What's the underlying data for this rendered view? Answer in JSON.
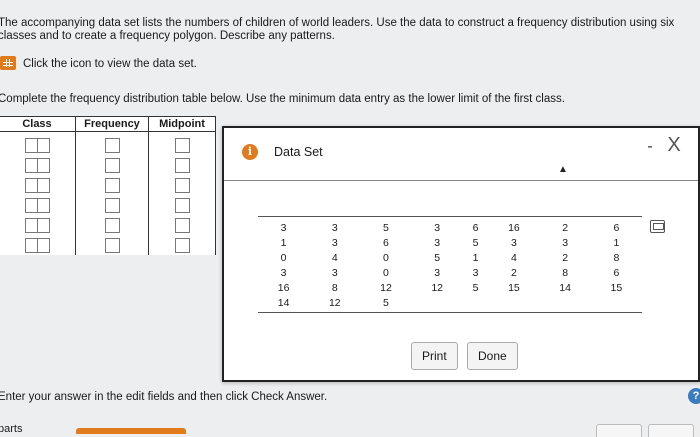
{
  "instructions": {
    "line1": "The accompanying data set lists the numbers of children of world leaders. Use the data to construct a frequency distribution using six",
    "line2": "classes and to create a frequency polygon. Describe any patterns.",
    "click_icon": "Click the icon to view the data set.",
    "complete": "Complete the frequency distribution table below. Use the minimum data entry as the lower limit of the first class."
  },
  "freq_table": {
    "headers": [
      "Class",
      "Frequency",
      "Midpoint"
    ],
    "row_count": 6
  },
  "dialog": {
    "title": "Data Set",
    "info_icon": "i",
    "minimize": "-",
    "close": "X",
    "rows": [
      [
        "3",
        "3",
        "5",
        "3",
        "6",
        "16",
        "2",
        "6"
      ],
      [
        "1",
        "3",
        "6",
        "3",
        "5",
        "3",
        "3",
        "1"
      ],
      [
        "0",
        "4",
        "0",
        "5",
        "1",
        "4",
        "2",
        "8"
      ],
      [
        "3",
        "3",
        "0",
        "3",
        "3",
        "2",
        "8",
        "6"
      ],
      [
        "16",
        "8",
        "12",
        "12",
        "5",
        "15",
        "14",
        "15"
      ],
      [
        "14",
        "12",
        "5",
        "",
        "",
        "",
        "",
        ""
      ]
    ],
    "print_label": "Print",
    "done_label": "Done"
  },
  "footer": {
    "enter_text": "Enter your answer in the edit fields and then click Check Answer.",
    "parts_text": "parts",
    "help": "?"
  },
  "colors": {
    "accent": "#e07a1d",
    "help": "#3b7bbf"
  }
}
